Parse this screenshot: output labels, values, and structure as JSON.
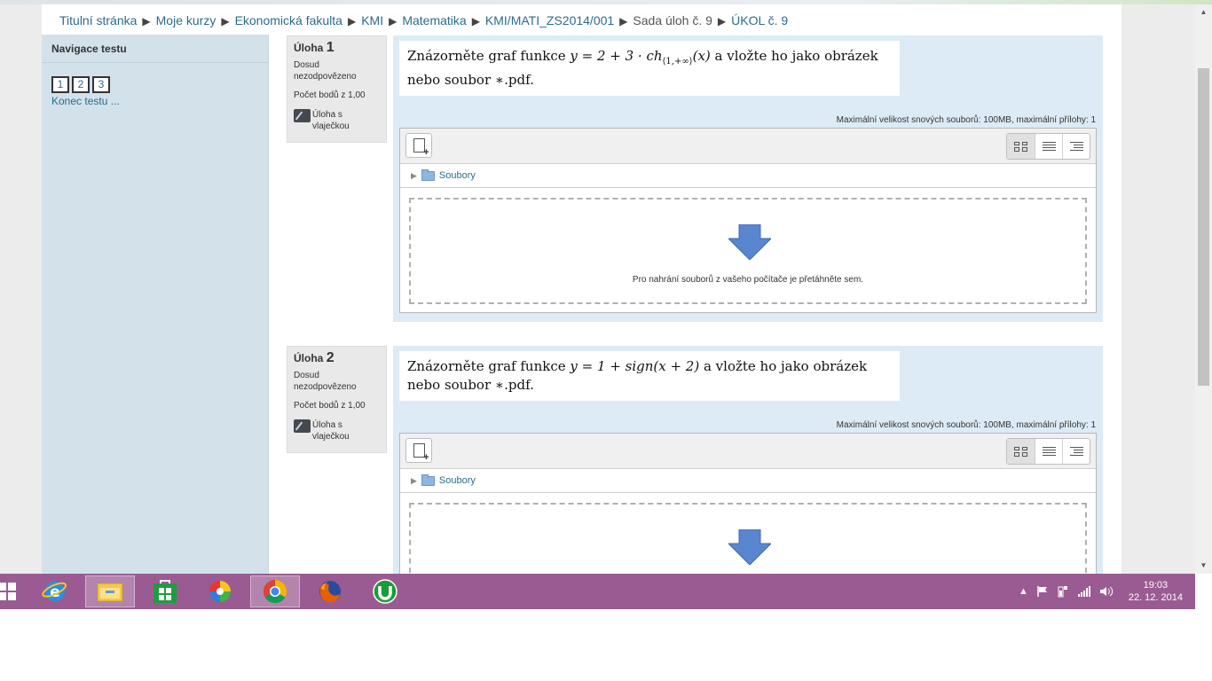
{
  "breadcrumb": [
    "Titulní stránka",
    "Moje kurzy",
    "Ekonomická fakulta",
    "KMI",
    "Matematika",
    "KMI/MATI_ZS2014/001",
    "Sada úloh č. 9",
    "ÚKOL č. 9"
  ],
  "sidebar": {
    "title": "Navigace testu",
    "questions": [
      "1",
      "2",
      "3"
    ],
    "finish_link": "Konec testu ..."
  },
  "questions": [
    {
      "label": "Úloha",
      "number": "1",
      "state": "Dosud nezodpovězeno",
      "grade": "Počet bodů z 1,00",
      "flag": "Úloha s vlaječkou",
      "text_pre": "Znázorněte graf funkce ",
      "text_post": " a vložte ho jako obrázek nebo soubor ∗.pdf.",
      "max_size": "Maximální velikost snových souborů: 100MB, maximální přílohy: 1",
      "folder": "Soubory",
      "drop_text": "Pro nahrání souborů z vašeho počítače je přetáhněte sem."
    },
    {
      "label": "Úloha",
      "number": "2",
      "state": "Dosud nezodpovězeno",
      "grade": "Počet bodů z 1,00",
      "flag": "Úloha s vlaječkou",
      "text_pre": "Znázorněte graf funkce ",
      "text_post": " a vložte ho jako obrázek nebo soubor ∗.pdf.",
      "max_size": "Maximální velikost snových souborů: 100MB, maximální přílohy: 1",
      "folder": "Soubory"
    }
  ],
  "formula1": {
    "main": "y = 2 + 3 · ch",
    "sub": "⟨1,+∞⟩",
    "tail": "(x)"
  },
  "formula2": {
    "main": "y = 1 + sign(x + 2)"
  },
  "taskbar": {
    "apps": [
      "start-icon",
      "internet-explorer-icon",
      "file-explorer-icon",
      "store-icon",
      "picasa-icon",
      "chrome-icon",
      "firefox-icon",
      "utorrent-icon"
    ],
    "time": "19:03",
    "date": "22. 12. 2014"
  },
  "colors": {
    "link": "#2b6c8e",
    "sidebar": "#d2e1ea",
    "taskbar": "#9a5b92",
    "question_bg": "#dcebf6"
  }
}
